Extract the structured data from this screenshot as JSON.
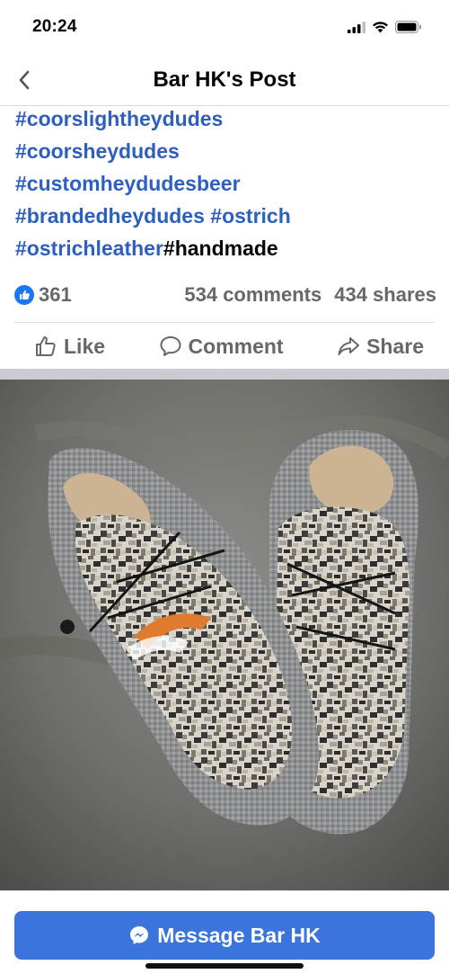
{
  "status_bar": {
    "time": "20:24"
  },
  "nav": {
    "title": "Bar HK's Post"
  },
  "post": {
    "hashtags_line1": "#coorslightheydudes",
    "hashtags_line2": "#coorsheydudes",
    "hashtags_line3": "#customheydudesbeer",
    "hashtags_line4a": "#brandedheydudes",
    "hashtags_line4b": "#ostrich",
    "hashtags_line5a": "#ostrichleather",
    "hashtags_line5b": "#handmade"
  },
  "stats": {
    "likes": "361",
    "comments": "534 comments",
    "shares": "434 shares"
  },
  "actions": {
    "like_label": "Like",
    "comment_label": "Comment",
    "share_label": "Share"
  },
  "photo": {
    "icon": "camo-slip-on-shoes-photo"
  },
  "bottom": {
    "message_label": "Message Bar HK"
  },
  "colors": {
    "accent": "#3a74dc",
    "hashtag": "#2d5fbf",
    "muted": "#65676b",
    "reaction": "#1877f2"
  }
}
